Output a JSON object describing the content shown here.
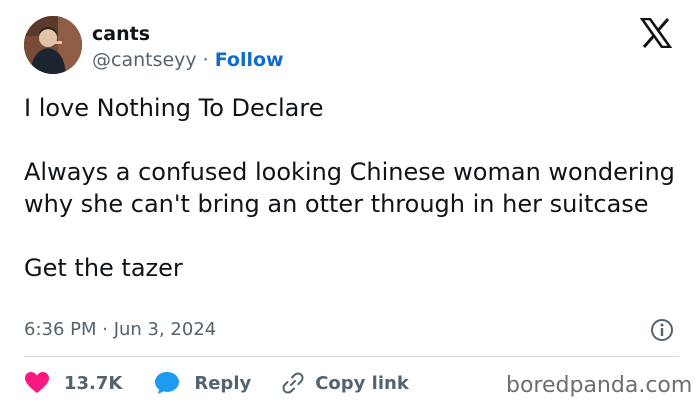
{
  "author": {
    "name": "cants",
    "handle": "@cantseyy",
    "separator": "·",
    "follow_label": "Follow"
  },
  "tweet": {
    "paragraphs": [
      "I love Nothing To Declare",
      "Always a confused looking Chinese woman wondering why she can't bring an otter through in her suitcase",
      "Get the tazer"
    ],
    "timestamp": "6:36 PM · Jun 3, 2024"
  },
  "actions": {
    "like_count": "13.7K",
    "reply_label": "Reply",
    "copy_link_label": "Copy link"
  },
  "watermark": "boredpanda.com",
  "icons": {
    "brand": "x-logo-icon",
    "like": "heart-icon",
    "reply": "speech-bubble-icon",
    "copy": "link-icon",
    "info": "info-icon"
  },
  "colors": {
    "follow": "#0f6ccf",
    "like": "#f91880",
    "reply": "#1d9bf0",
    "secondary_text": "#536471",
    "divider": "#cfd9de"
  }
}
